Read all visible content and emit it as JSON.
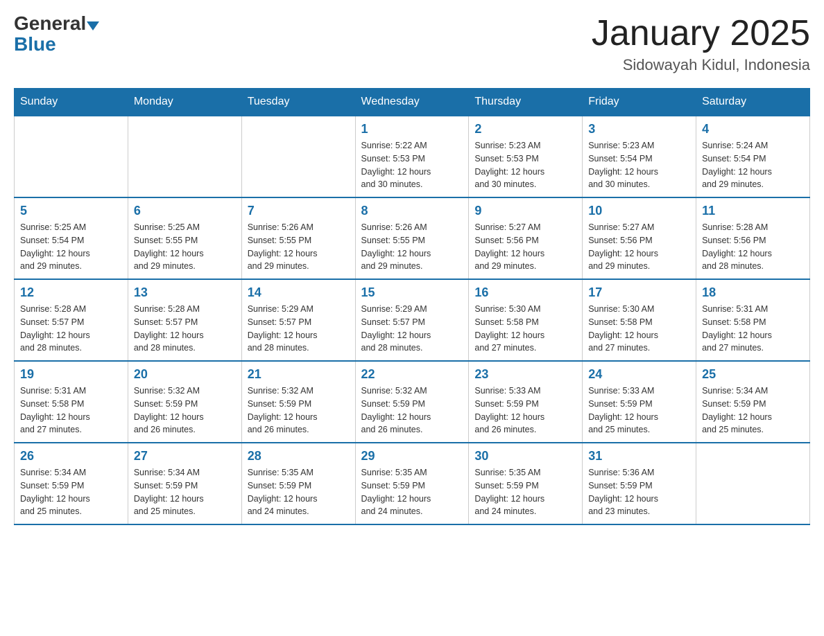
{
  "header": {
    "logo_general": "General",
    "logo_blue": "Blue",
    "month_title": "January 2025",
    "location": "Sidowayah Kidul, Indonesia"
  },
  "weekdays": [
    "Sunday",
    "Monday",
    "Tuesday",
    "Wednesday",
    "Thursday",
    "Friday",
    "Saturday"
  ],
  "weeks": [
    [
      {
        "day": "",
        "info": ""
      },
      {
        "day": "",
        "info": ""
      },
      {
        "day": "",
        "info": ""
      },
      {
        "day": "1",
        "info": "Sunrise: 5:22 AM\nSunset: 5:53 PM\nDaylight: 12 hours\nand 30 minutes."
      },
      {
        "day": "2",
        "info": "Sunrise: 5:23 AM\nSunset: 5:53 PM\nDaylight: 12 hours\nand 30 minutes."
      },
      {
        "day": "3",
        "info": "Sunrise: 5:23 AM\nSunset: 5:54 PM\nDaylight: 12 hours\nand 30 minutes."
      },
      {
        "day": "4",
        "info": "Sunrise: 5:24 AM\nSunset: 5:54 PM\nDaylight: 12 hours\nand 29 minutes."
      }
    ],
    [
      {
        "day": "5",
        "info": "Sunrise: 5:25 AM\nSunset: 5:54 PM\nDaylight: 12 hours\nand 29 minutes."
      },
      {
        "day": "6",
        "info": "Sunrise: 5:25 AM\nSunset: 5:55 PM\nDaylight: 12 hours\nand 29 minutes."
      },
      {
        "day": "7",
        "info": "Sunrise: 5:26 AM\nSunset: 5:55 PM\nDaylight: 12 hours\nand 29 minutes."
      },
      {
        "day": "8",
        "info": "Sunrise: 5:26 AM\nSunset: 5:55 PM\nDaylight: 12 hours\nand 29 minutes."
      },
      {
        "day": "9",
        "info": "Sunrise: 5:27 AM\nSunset: 5:56 PM\nDaylight: 12 hours\nand 29 minutes."
      },
      {
        "day": "10",
        "info": "Sunrise: 5:27 AM\nSunset: 5:56 PM\nDaylight: 12 hours\nand 29 minutes."
      },
      {
        "day": "11",
        "info": "Sunrise: 5:28 AM\nSunset: 5:56 PM\nDaylight: 12 hours\nand 28 minutes."
      }
    ],
    [
      {
        "day": "12",
        "info": "Sunrise: 5:28 AM\nSunset: 5:57 PM\nDaylight: 12 hours\nand 28 minutes."
      },
      {
        "day": "13",
        "info": "Sunrise: 5:28 AM\nSunset: 5:57 PM\nDaylight: 12 hours\nand 28 minutes."
      },
      {
        "day": "14",
        "info": "Sunrise: 5:29 AM\nSunset: 5:57 PM\nDaylight: 12 hours\nand 28 minutes."
      },
      {
        "day": "15",
        "info": "Sunrise: 5:29 AM\nSunset: 5:57 PM\nDaylight: 12 hours\nand 28 minutes."
      },
      {
        "day": "16",
        "info": "Sunrise: 5:30 AM\nSunset: 5:58 PM\nDaylight: 12 hours\nand 27 minutes."
      },
      {
        "day": "17",
        "info": "Sunrise: 5:30 AM\nSunset: 5:58 PM\nDaylight: 12 hours\nand 27 minutes."
      },
      {
        "day": "18",
        "info": "Sunrise: 5:31 AM\nSunset: 5:58 PM\nDaylight: 12 hours\nand 27 minutes."
      }
    ],
    [
      {
        "day": "19",
        "info": "Sunrise: 5:31 AM\nSunset: 5:58 PM\nDaylight: 12 hours\nand 27 minutes."
      },
      {
        "day": "20",
        "info": "Sunrise: 5:32 AM\nSunset: 5:59 PM\nDaylight: 12 hours\nand 26 minutes."
      },
      {
        "day": "21",
        "info": "Sunrise: 5:32 AM\nSunset: 5:59 PM\nDaylight: 12 hours\nand 26 minutes."
      },
      {
        "day": "22",
        "info": "Sunrise: 5:32 AM\nSunset: 5:59 PM\nDaylight: 12 hours\nand 26 minutes."
      },
      {
        "day": "23",
        "info": "Sunrise: 5:33 AM\nSunset: 5:59 PM\nDaylight: 12 hours\nand 26 minutes."
      },
      {
        "day": "24",
        "info": "Sunrise: 5:33 AM\nSunset: 5:59 PM\nDaylight: 12 hours\nand 25 minutes."
      },
      {
        "day": "25",
        "info": "Sunrise: 5:34 AM\nSunset: 5:59 PM\nDaylight: 12 hours\nand 25 minutes."
      }
    ],
    [
      {
        "day": "26",
        "info": "Sunrise: 5:34 AM\nSunset: 5:59 PM\nDaylight: 12 hours\nand 25 minutes."
      },
      {
        "day": "27",
        "info": "Sunrise: 5:34 AM\nSunset: 5:59 PM\nDaylight: 12 hours\nand 25 minutes."
      },
      {
        "day": "28",
        "info": "Sunrise: 5:35 AM\nSunset: 5:59 PM\nDaylight: 12 hours\nand 24 minutes."
      },
      {
        "day": "29",
        "info": "Sunrise: 5:35 AM\nSunset: 5:59 PM\nDaylight: 12 hours\nand 24 minutes."
      },
      {
        "day": "30",
        "info": "Sunrise: 5:35 AM\nSunset: 5:59 PM\nDaylight: 12 hours\nand 24 minutes."
      },
      {
        "day": "31",
        "info": "Sunrise: 5:36 AM\nSunset: 5:59 PM\nDaylight: 12 hours\nand 23 minutes."
      },
      {
        "day": "",
        "info": ""
      }
    ]
  ]
}
